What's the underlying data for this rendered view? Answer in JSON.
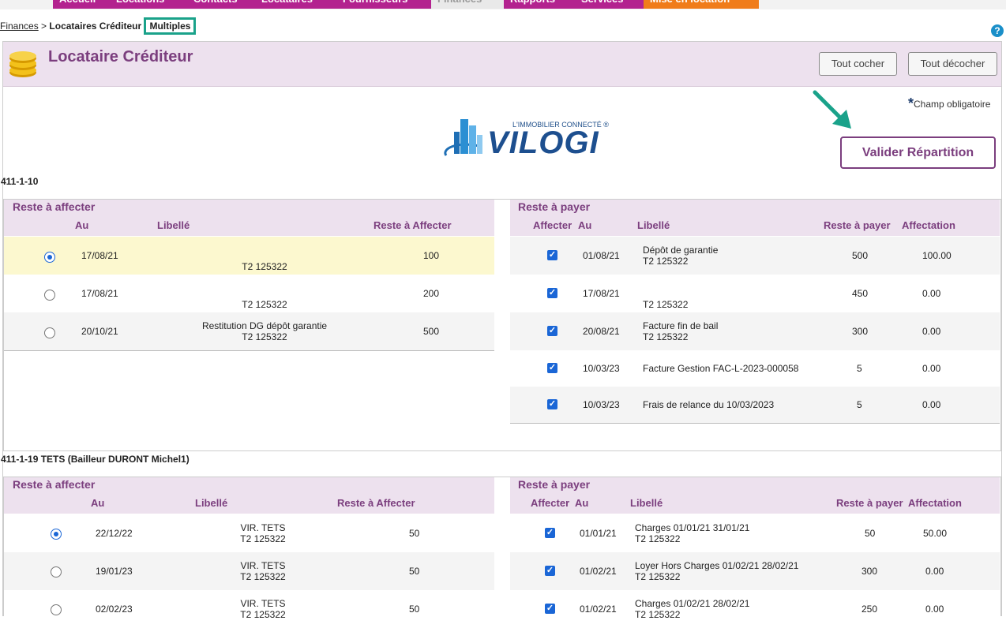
{
  "nav": {
    "tabs": [
      "Accueil",
      "Locations",
      "Contacts",
      "Locataires",
      "Fournisseurs",
      "Finances",
      "Rapports",
      "Services",
      "Mise en location"
    ],
    "colors": [
      "#b3228f",
      "#b3228f",
      "#b3228f",
      "#b3228f",
      "#b3228f",
      "#9a9a9a",
      "#b3228f",
      "#b3228f",
      "#f07c1a"
    ]
  },
  "breadcrumb": {
    "finances": "Finances",
    "sep1": ">",
    "creditors": "Locataires Créditeur",
    "multiples": "Multiples"
  },
  "help_icon": "?",
  "header": {
    "title": "Locataire Créditeur",
    "check_all": "Tout cocher",
    "uncheck_all": "Tout décocher",
    "icon": "coins-icon"
  },
  "required_note": {
    "star": "*",
    "text": "Champ obligatoire"
  },
  "logo": {
    "tagline": "L'IMMOBILIER CONNECTÉ ®",
    "brand": "VILOGI"
  },
  "validate_button": "Valider Répartition",
  "accent_colors": {
    "purple": "#7b3e7e",
    "header_bg": "#ede1ee",
    "selected_row": "#fcf8cf",
    "teal": "#1aa28a",
    "blue": "#1a66d6"
  },
  "sections": [
    {
      "account": "411-1-10",
      "left": {
        "caption": "Reste à affecter",
        "headers": [
          "Au",
          "Libellé",
          "Reste à Affecter"
        ],
        "rows": [
          {
            "selected": true,
            "date": "17/08/21",
            "label1": "",
            "label2": "T2 125322",
            "amount": "100"
          },
          {
            "selected": false,
            "date": "17/08/21",
            "label1": "",
            "label2": "T2 125322",
            "amount": "200"
          },
          {
            "selected": false,
            "date": "20/10/21",
            "label1": "Restitution DG dépôt garantie",
            "label2": "T2 125322",
            "amount": "500"
          }
        ]
      },
      "right": {
        "caption": "Reste à payer",
        "headers": [
          "Affecter",
          "Au",
          "Libellé",
          "Reste à payer",
          "Affectation"
        ],
        "rows": [
          {
            "checked": true,
            "date": "01/08/21",
            "label1": "Dépôt de garantie",
            "label2": "T2 125322",
            "amount": "500",
            "allocation": "100.00"
          },
          {
            "checked": true,
            "date": "17/08/21",
            "label1": "",
            "label2": "T2 125322",
            "amount": "450",
            "allocation": "0.00"
          },
          {
            "checked": true,
            "date": "20/08/21",
            "label1": "Facture fin de bail",
            "label2": "T2 125322",
            "amount": "300",
            "allocation": "0.00"
          },
          {
            "checked": true,
            "date": "10/03/23",
            "label1": "Facture Gestion FAC-L-2023-000058",
            "label2": "",
            "amount": "5",
            "allocation": "0.00"
          },
          {
            "checked": true,
            "date": "10/03/23",
            "label1": "Frais de relance du 10/03/2023",
            "label2": "",
            "amount": "5",
            "allocation": "0.00"
          }
        ]
      }
    },
    {
      "account": "411-1-19 TETS (Bailleur DURONT Michel1)",
      "left": {
        "caption": "Reste à affecter",
        "headers": [
          "Au",
          "Libellé",
          "Reste à Affecter"
        ],
        "rows": [
          {
            "selected": true,
            "date": "22/12/22",
            "label1": "VIR. TETS",
            "label2": "T2 125322",
            "amount": "50"
          },
          {
            "selected": false,
            "date": "19/01/23",
            "label1": "VIR. TETS",
            "label2": "T2 125322",
            "amount": "50"
          },
          {
            "selected": false,
            "date": "02/02/23",
            "label1": "VIR. TETS",
            "label2": "T2 125322",
            "amount": "50"
          }
        ]
      },
      "right": {
        "caption": "Reste à payer",
        "headers": [
          "Affecter",
          "Au",
          "Libellé",
          "Reste à payer",
          "Affectation"
        ],
        "rows": [
          {
            "checked": true,
            "date": "01/01/21",
            "label1": "Charges 01/01/21 31/01/21",
            "label2": "T2 125322",
            "amount": "50",
            "allocation": "50.00"
          },
          {
            "checked": true,
            "date": "01/02/21",
            "label1": "Loyer Hors Charges 01/02/21 28/02/21",
            "label2": "T2 125322",
            "amount": "300",
            "allocation": "0.00"
          },
          {
            "checked": true,
            "date": "01/02/21",
            "label1": "Charges 01/02/21 28/02/21",
            "label2": "T2 125322",
            "amount": "250",
            "allocation": "0.00"
          }
        ]
      }
    }
  ]
}
